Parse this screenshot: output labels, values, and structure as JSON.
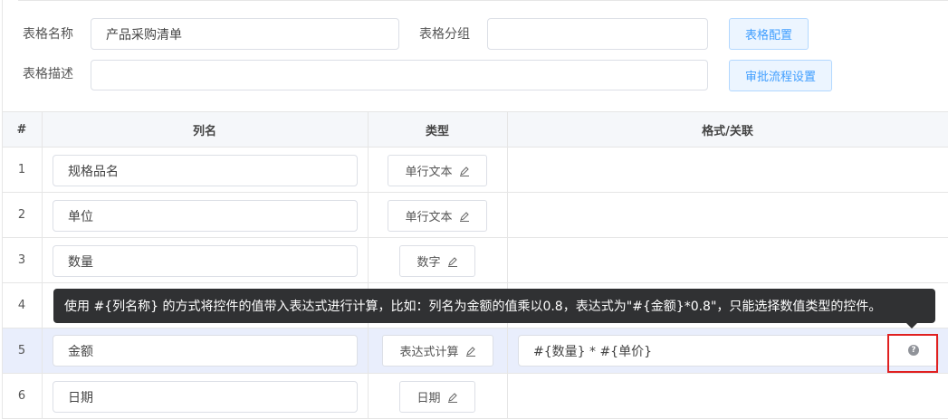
{
  "form": {
    "name_label": "表格名称",
    "name_value": "产品采购清单",
    "group_label": "表格分组",
    "group_value": "",
    "desc_label": "表格描述",
    "desc_value": "",
    "config_button": "表格配置",
    "approval_button": "审批流程设置"
  },
  "table": {
    "headers": [
      "#",
      "列名",
      "类型",
      "格式/关联"
    ],
    "rows": [
      {
        "num": "1",
        "name": "规格品名",
        "type": "单行文本",
        "format": ""
      },
      {
        "num": "2",
        "name": "单位",
        "type": "单行文本",
        "format": ""
      },
      {
        "num": "3",
        "name": "数量",
        "type": "数字",
        "format": ""
      },
      {
        "num": "4",
        "name": "",
        "type": "",
        "format": ""
      },
      {
        "num": "5",
        "name": "金额",
        "type": "表达式计算",
        "format": "#{数量} * #{单价}"
      },
      {
        "num": "6",
        "name": "日期",
        "type": "日期",
        "format": ""
      }
    ]
  },
  "tooltip": {
    "text": "使用 #{列名称} 的方式将控件的值带入表达式进行计算，比如：列名为金额的值乘以0.8，表达式为\"#{金额}*0.8\"，只能选择数值类型的控件。"
  },
  "icons": {
    "edit": "edit-pen-icon",
    "help": "question-circle-icon"
  },
  "colors": {
    "accent": "#409eff",
    "highlight_row": "#e9eefc",
    "tooltip_bg": "#303133",
    "annotation_red": "#e02020"
  }
}
